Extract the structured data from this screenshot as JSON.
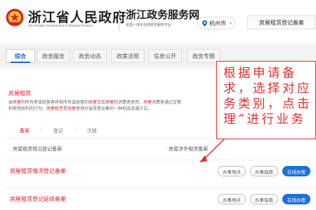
{
  "header": {
    "site_name_cn": "浙江省人民政府",
    "site_name_en": "The People's Government of Zhejiang Province",
    "service_net_cn": "浙江政务服务网",
    "service_net_sub": "全国一体化在线政务服务平台",
    "city_selector": "杭州市",
    "search_value": "房屋租赁登记备案",
    "emblem_color": "#d8282c"
  },
  "tabs": [
    {
      "label": "综合",
      "active": true
    },
    {
      "label": "政务服务",
      "active": false
    },
    {
      "label": "政务动态",
      "active": false
    },
    {
      "label": "政策法规",
      "active": false
    },
    {
      "label": "信息公开",
      "active": false
    },
    {
      "label": "政务专题",
      "active": false
    }
  ],
  "section": {
    "title": "房屋租赁",
    "desc_p1": "由",
    "desc_h1": "房屋",
    "desc_p2": "的所有者或经营者将其所有或经营的",
    "desc_h2": "房屋",
    "desc_p3": "交给",
    "desc_h3": "房屋",
    "desc_p4": "的消费者使用，",
    "desc_h4": "房屋",
    "desc_p5": "消费者通过定期",
    "desc_line2_p1": "和使用权利的行为。",
    "desc_line2_h1": "房屋租赁",
    "desc_line2_p2": "是",
    "desc_line2_h2": "房屋",
    "desc_line2_p3": "使用价值零星出售的一种商品流通方式。",
    "categories": [
      {
        "label": "备案",
        "active": true
      },
      {
        "label": "登记",
        "active": false
      },
      {
        "label": "注销",
        "active": false
      }
    ],
    "sep": "|"
  },
  "items_lite": [
    "· 房屋租赁情况登记备案",
    "· 房屋涉外租赁备案"
  ],
  "services": [
    {
      "title": "房屋租赁情况登记备案",
      "btn_location": "办事地点",
      "btn_guide": "办事指南",
      "btn_online": "在线办理"
    },
    {
      "title": "房屋租赁登记延续备案",
      "btn_location": "办事地点",
      "btn_guide": "办事指南",
      "btn_online": "在线办理"
    }
  ],
  "annotation": {
    "text": "根据申请备\n求，选择对应\n务类别，点击\n理”进行业务",
    "color": "#e03030"
  }
}
